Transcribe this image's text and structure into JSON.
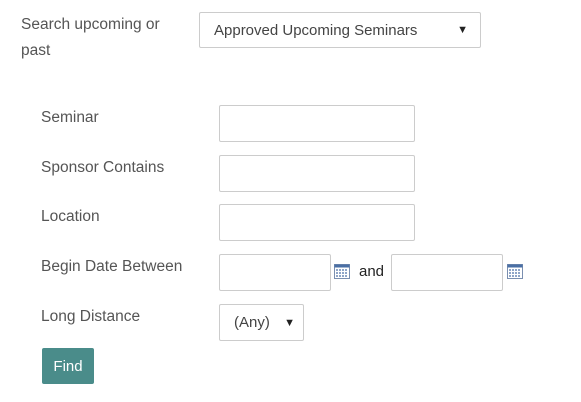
{
  "search": {
    "label": "Search upcoming or past",
    "selected": "Approved Upcoming Seminars"
  },
  "fields": {
    "seminar_label": "Seminar",
    "sponsor_label": "Sponsor Contains",
    "location_label": "Location",
    "begin_date_label": "Begin Date Between",
    "and_label": "and",
    "long_distance_label": "Long Distance",
    "long_distance_selected": "(Any)"
  },
  "actions": {
    "find_label": "Find"
  },
  "colors": {
    "button_bg": "#4a8c8a",
    "border": "#cccccc"
  },
  "icons": {
    "calendar": "calendar-icon",
    "dropdown": "triangle-down"
  }
}
